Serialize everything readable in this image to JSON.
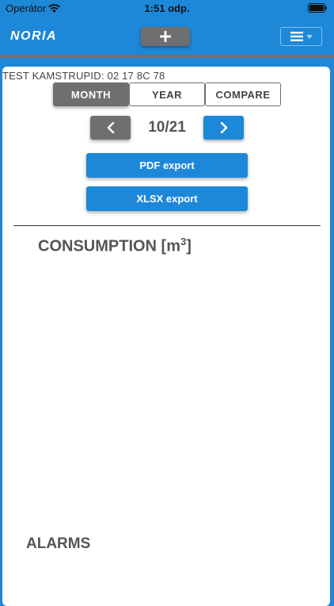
{
  "status_bar": {
    "carrier": "Operátor",
    "time": "1:51 odp."
  },
  "navbar": {
    "logo": "NORIA",
    "add_label": "+",
    "menu_icon": "hamburger-icon"
  },
  "colors": {
    "brand_blue": "#1e88d8",
    "button_gray": "#6f6f72",
    "text_gray": "#555555"
  },
  "device": {
    "title": "TEST KAMSTRUPID: 02 17 8C 78"
  },
  "tabs": [
    {
      "label": "MONTH",
      "active": true
    },
    {
      "label": "YEAR",
      "active": false
    },
    {
      "label": "COMPARE",
      "active": false
    }
  ],
  "period": {
    "label": "10/21",
    "prev_icon": "chevron-left-icon",
    "next_icon": "chevron-right-icon"
  },
  "exports": {
    "pdf_label": "PDF export",
    "xlsx_label": "XLSX export"
  },
  "sections": {
    "consumption_title": "CONSUMPTION [m",
    "consumption_unit_sup": "3",
    "consumption_suffix": "]",
    "alarms_title": "ALARMS"
  }
}
